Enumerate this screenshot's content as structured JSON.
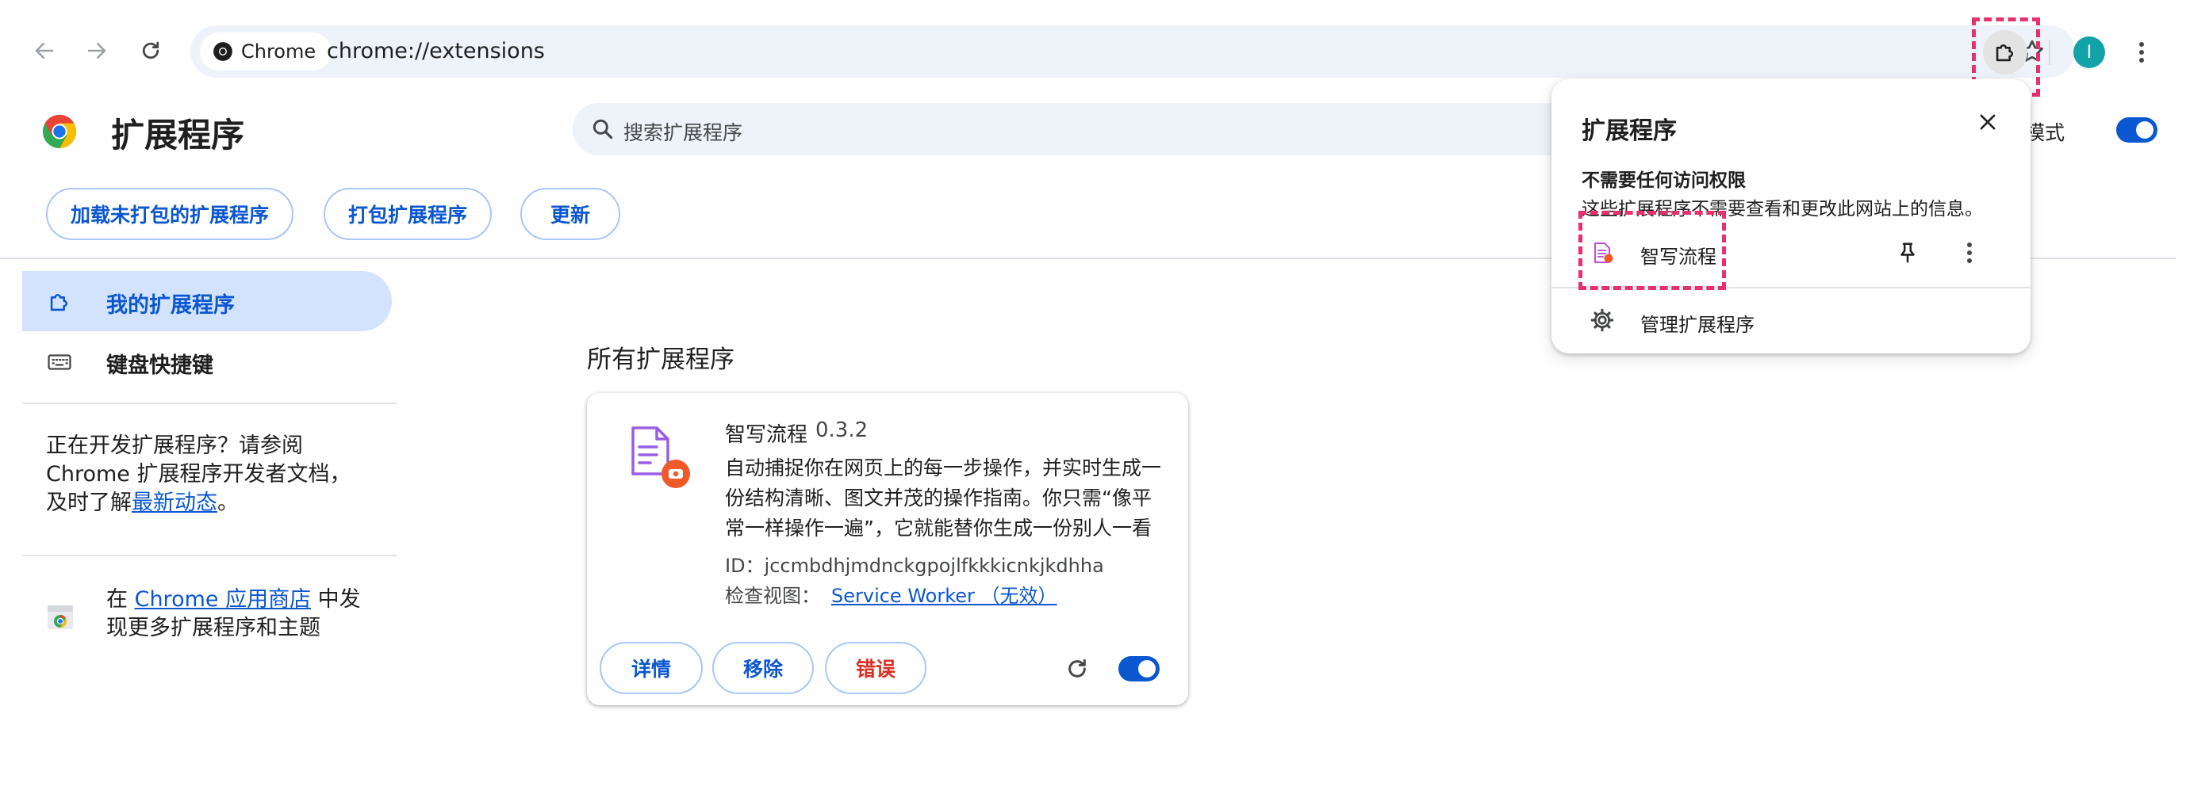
{
  "browser": {
    "chip_label": "Chrome",
    "url": "chrome://extensions",
    "avatar_letter": "I"
  },
  "header": {
    "title": "扩展程序",
    "search_placeholder": "搜索扩展程序",
    "dev_mode_label": "者模式",
    "dev_mode_on": true
  },
  "actions": {
    "load_unpacked": "加载未打包的扩展程序",
    "pack": "打包扩展程序",
    "update": "更新"
  },
  "sidebar": {
    "items": [
      {
        "label": "我的扩展程序",
        "icon": "extension-icon",
        "active": true
      },
      {
        "label": "键盘快捷键",
        "icon": "keyboard-icon",
        "active": false
      }
    ],
    "dev_text_1": "正在开发扩展程序？请参阅",
    "dev_text_2": "Chrome 扩展程序开发者文档，",
    "dev_text_3_prefix": "及时了解",
    "dev_text_3_link": "最新动态",
    "dev_text_3_suffix": "。",
    "store_prefix": "在 ",
    "store_link": "Chrome 应用商店",
    "store_suffix": " 中发",
    "store_line2": "现更多扩展程序和主题"
  },
  "main": {
    "section_title": "所有扩展程序",
    "extension": {
      "name": "智写流程",
      "version": "0.3.2",
      "description": "自动捕捉你在网页上的每一步操作，并实时生成一份结构清晰、图文并茂的操作指南。你只需“像平常一样操作一遍”，它就能替你生成一份别人一看",
      "id_text": "ID：jccmbdhjmdnckgpojlfkkkicnkjkdhha",
      "inspect_label": "检查视图：",
      "inspect_link": "Service Worker （无效）",
      "details_btn": "详情",
      "remove_btn": "移除",
      "errors_btn": "错误",
      "enabled": true
    }
  },
  "popup": {
    "title": "扩展程序",
    "subtitle": "不需要任何访问权限",
    "description": "这些扩展程序不需要查看和更改此网站上的信息。",
    "extension_name": "智写流程",
    "manage_label": "管理扩展程序"
  },
  "colors": {
    "accent": "#0b57d0",
    "highlight": "#e8306b",
    "error": "#d93025"
  }
}
